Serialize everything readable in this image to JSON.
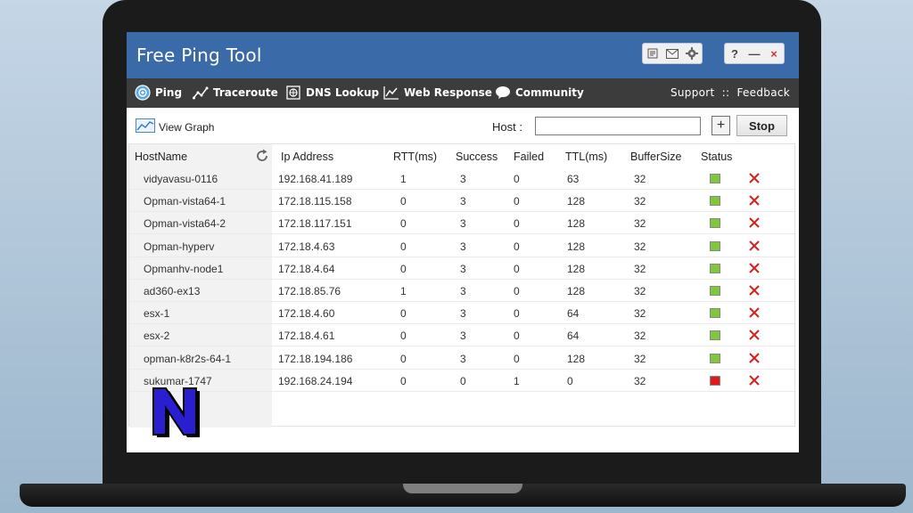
{
  "window": {
    "title": "Free Ping Tool"
  },
  "titlebar_icons": [
    "notes-icon",
    "mail-icon",
    "settings-icon"
  ],
  "window_controls": {
    "help": "?",
    "minimize": "—",
    "close": "×"
  },
  "nav": {
    "items": [
      {
        "label": "Ping",
        "icon": "ping-icon"
      },
      {
        "label": "Traceroute",
        "icon": "traceroute-icon"
      },
      {
        "label": "DNS Lookup",
        "icon": "dns-lookup-icon"
      },
      {
        "label": "Web Response",
        "icon": "web-response-icon"
      },
      {
        "label": "Community",
        "icon": "community-icon"
      }
    ],
    "support": "Support",
    "separator": "::",
    "feedback": "Feedback"
  },
  "toolbar": {
    "view_graph": "View Graph",
    "host_label": "Host :",
    "host_value": "",
    "add_label": "+",
    "stop_label": "Stop"
  },
  "table": {
    "columns": [
      "HostName",
      "Ip Address",
      "RTT(ms)",
      "Success",
      "Failed",
      "TTL(ms)",
      "BufferSize",
      "Status"
    ],
    "rows": [
      {
        "host": "vidyavasu-0116",
        "ip": "192.168.41.189",
        "rtt": "1",
        "success": "3",
        "failed": "0",
        "ttl": "63",
        "buffer": "32",
        "status": "up"
      },
      {
        "host": "Opman-vista64-1",
        "ip": "172.18.115.158",
        "rtt": "0",
        "success": "3",
        "failed": "0",
        "ttl": "128",
        "buffer": "32",
        "status": "up"
      },
      {
        "host": "Opman-vista64-2",
        "ip": "172.18.117.151",
        "rtt": "0",
        "success": "3",
        "failed": "0",
        "ttl": "128",
        "buffer": "32",
        "status": "up"
      },
      {
        "host": "Opman-hyperv",
        "ip": "172.18.4.63",
        "rtt": "0",
        "success": "3",
        "failed": "0",
        "ttl": "128",
        "buffer": "32",
        "status": "up"
      },
      {
        "host": "Opmanhv-node1",
        "ip": "172.18.4.64",
        "rtt": "0",
        "success": "3",
        "failed": "0",
        "ttl": "128",
        "buffer": "32",
        "status": "up"
      },
      {
        "host": "ad360-ex13",
        "ip": "172.18.85.76",
        "rtt": "1",
        "success": "3",
        "failed": "0",
        "ttl": "128",
        "buffer": "32",
        "status": "up"
      },
      {
        "host": "esx-1",
        "ip": "172.18.4.60",
        "rtt": "0",
        "success": "3",
        "failed": "0",
        "ttl": "64",
        "buffer": "32",
        "status": "up"
      },
      {
        "host": "esx-2",
        "ip": "172.18.4.61",
        "rtt": "0",
        "success": "3",
        "failed": "0",
        "ttl": "64",
        "buffer": "32",
        "status": "up"
      },
      {
        "host": "opman-k8r2s-64-1",
        "ip": "172.18.194.186",
        "rtt": "0",
        "success": "3",
        "failed": "0",
        "ttl": "128",
        "buffer": "32",
        "status": "up"
      },
      {
        "host": "sukumar-1747",
        "ip": "192.168.24.194",
        "rtt": "0",
        "success": "0",
        "failed": "1",
        "ttl": "0",
        "buffer": "32",
        "status": "down"
      }
    ]
  },
  "colors": {
    "titlebar": "#3b6aa8",
    "navbar": "#3c3c3c",
    "status_up": "#7ec83a",
    "status_down": "#e01a1a",
    "delete": "#d82020",
    "logo_fill": "#2a1fd0"
  }
}
